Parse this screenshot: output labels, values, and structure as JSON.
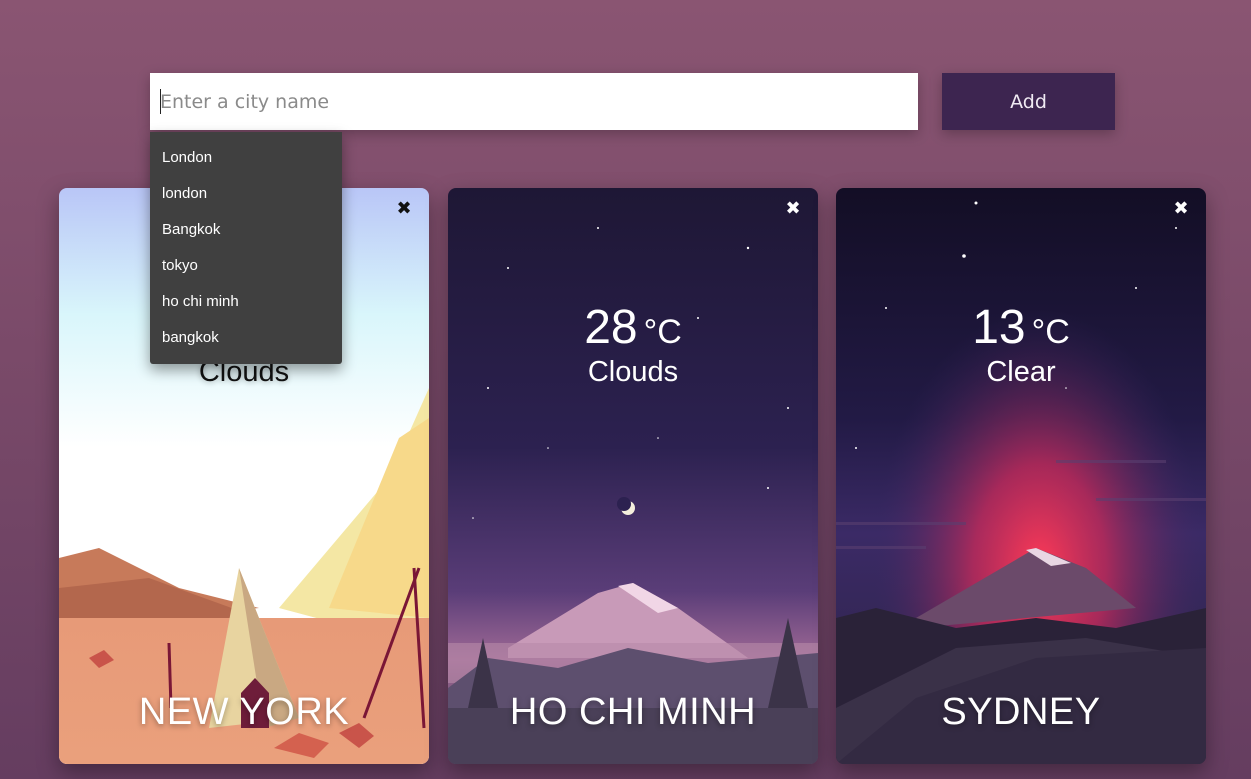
{
  "search": {
    "placeholder": "Enter a city name",
    "value": "",
    "add_label": "Add"
  },
  "suggestions": [
    "London",
    "london",
    "Bangkok",
    "tokyo",
    "ho chi minh",
    "bangkok"
  ],
  "cards": [
    {
      "city": "NEW YORK",
      "temperature": "",
      "unit": "",
      "condition": "Clouds",
      "theme": "day-desert",
      "close_icon": "close-icon"
    },
    {
      "city": "HO CHI MINH",
      "temperature": "28",
      "unit": "°C",
      "condition": "Clouds",
      "theme": "night-mountain",
      "close_icon": "close-icon"
    },
    {
      "city": "SYDNEY",
      "temperature": "13",
      "unit": "°C",
      "condition": "Clear",
      "theme": "night-sunset-mountain",
      "close_icon": "close-icon"
    }
  ],
  "colors": {
    "background": "#7a4a69",
    "add_button": "#3d2550",
    "dropdown": "#404040"
  }
}
